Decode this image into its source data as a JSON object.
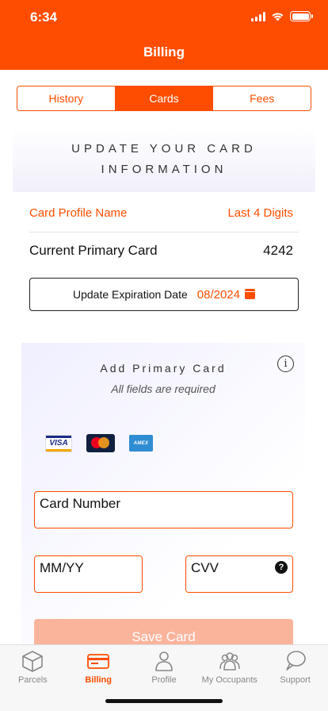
{
  "status_bar": {
    "time": "6:34"
  },
  "header": {
    "title": "Billing"
  },
  "tabs": [
    {
      "label": "History",
      "active": false
    },
    {
      "label": "Cards",
      "active": true
    },
    {
      "label": "Fees",
      "active": false
    }
  ],
  "update_banner": {
    "text": "UPDATE YOUR CARD INFORMATION"
  },
  "card_profile": {
    "name_header": "Card Profile Name",
    "digits_header": "Last 4 Digits",
    "name": "Current Primary Card",
    "last4": "4242"
  },
  "update_expiration": {
    "label": "Update Expiration Date",
    "date": "08/2024",
    "icon": "calendar-icon"
  },
  "add_card": {
    "title": "Add Primary Card",
    "subtitle": "All fields are required",
    "info_icon": "info-icon",
    "brands": [
      "VISA",
      "MasterCard",
      "AMEX"
    ],
    "card_number_placeholder": "Card Number",
    "expiry_placeholder": "MM/YY",
    "cvv_placeholder": "CVV",
    "cvv_help_icon": "question-icon",
    "save_label": "Save Card"
  },
  "colors": {
    "accent": "#ff4d00",
    "save_disabled": "#fbb49c"
  },
  "tabbar": [
    {
      "label": "Parcels",
      "icon": "box-icon",
      "active": false
    },
    {
      "label": "Billing",
      "icon": "card-icon",
      "active": true
    },
    {
      "label": "Profile",
      "icon": "person-icon",
      "active": false
    },
    {
      "label": "My Occupants",
      "icon": "group-icon",
      "active": false
    },
    {
      "label": "Support",
      "icon": "chat-icon",
      "active": false
    }
  ]
}
